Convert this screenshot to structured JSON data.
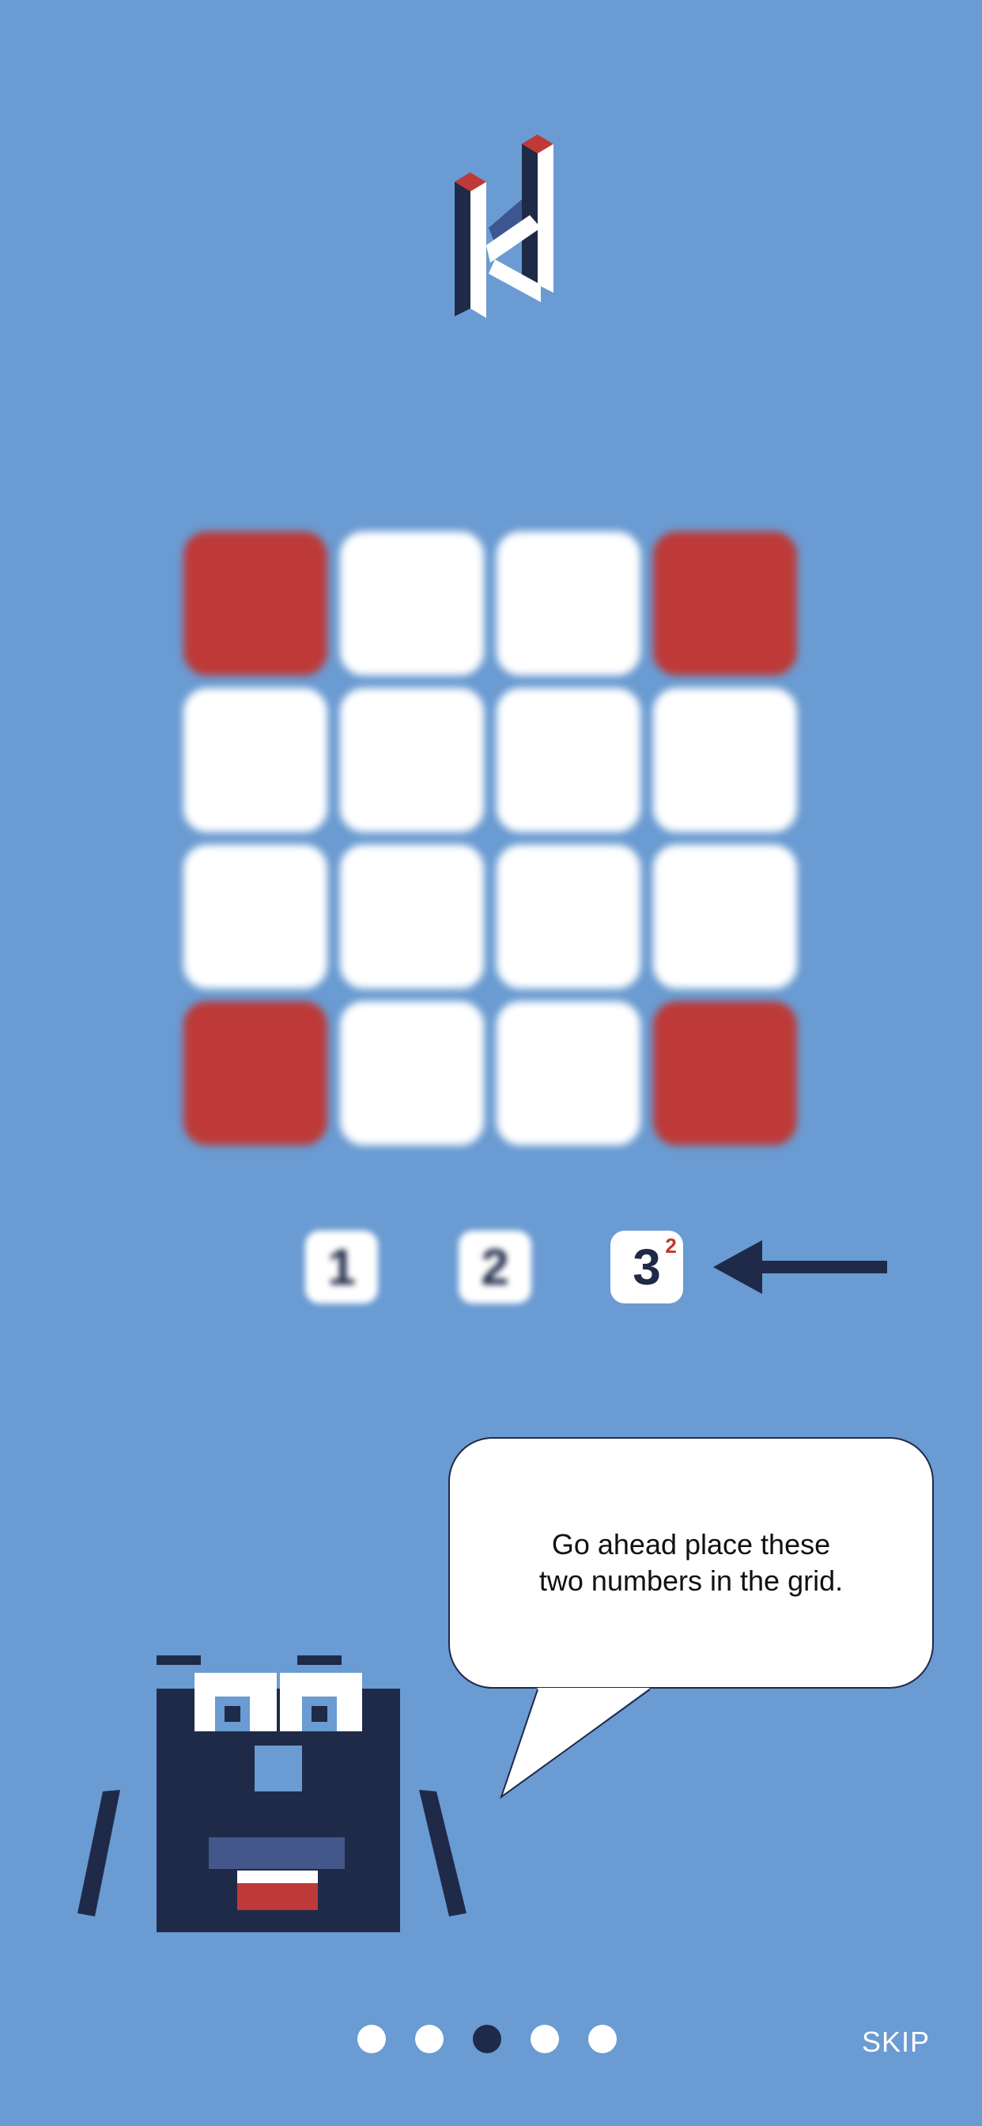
{
  "logo": {
    "icon": "k-logo-icon"
  },
  "grid": {
    "cells": [
      "red",
      "white",
      "white",
      "red",
      "white",
      "white",
      "white",
      "white",
      "white",
      "white",
      "white",
      "white",
      "red",
      "white",
      "white",
      "red"
    ]
  },
  "tiles": [
    {
      "number": "1",
      "superscript": "",
      "blurred": true
    },
    {
      "number": "2",
      "superscript": "",
      "blurred": true
    },
    {
      "number": "3",
      "superscript": "2",
      "blurred": false
    }
  ],
  "speech_bubble": {
    "line1": "Go ahead place these",
    "line2": "two numbers in the grid."
  },
  "pagination": {
    "total": 5,
    "active_index": 2
  },
  "skip_label": "SKIP",
  "colors": {
    "background": "#6a9bd2",
    "red": "#bd3a38",
    "navy": "#1f2a48",
    "white": "#ffffff"
  }
}
